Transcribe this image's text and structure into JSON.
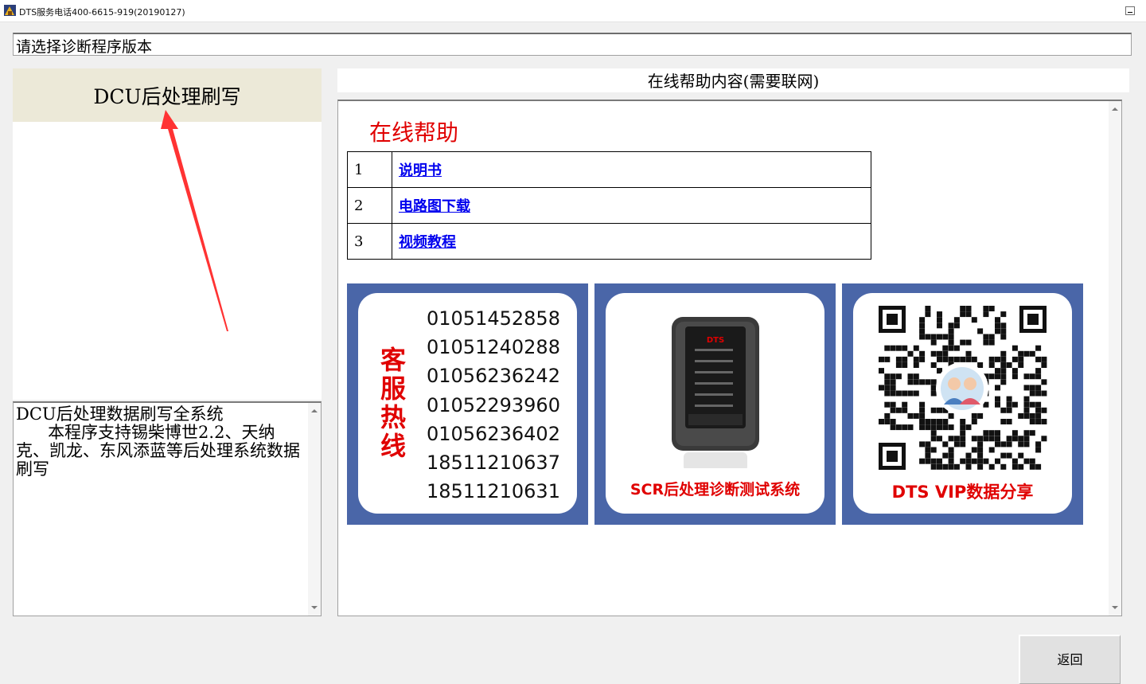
{
  "window": {
    "title": "DTS服务电话400-6615-919(20190127)",
    "minimize_icon": "minimize-icon"
  },
  "prompt": {
    "text": "请选择诊断程序版本"
  },
  "program_list": {
    "items": [
      {
        "label": "DCU后处理刷写",
        "selected": true
      }
    ]
  },
  "description": {
    "text": "DCU后处理数据刷写全系统\n      本程序支持锡柴博世2.2、天纳克、凯龙、东风添蓝等后处理系统数据刷写"
  },
  "help": {
    "header": "在线帮助内容(需要联网)",
    "title": "在线帮助",
    "links": [
      {
        "num": "1",
        "label": "说明书"
      },
      {
        "num": "2",
        "label": "电路图下载"
      },
      {
        "num": "3",
        "label": "视频教程"
      }
    ],
    "banners": {
      "hotline": {
        "heading": "客服热线",
        "phones": [
          "01051452858",
          "01051240288",
          "01056236242",
          "01052293960",
          "01056236402",
          "18511210637",
          "18511210631"
        ]
      },
      "device": {
        "device_brand": "DTS",
        "caption": "SCR后处理诊断测试系统"
      },
      "qr": {
        "caption": "DTS  VIP数据分享"
      }
    }
  },
  "buttons": {
    "back": "返回"
  },
  "colors": {
    "accent_red": "#e00000",
    "banner_blue": "#4a66a8",
    "selection_bg": "#ece9d8",
    "link_blue": "#0000ee"
  }
}
